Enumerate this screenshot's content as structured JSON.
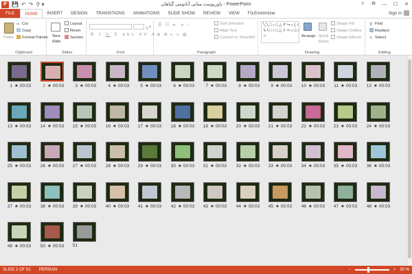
{
  "window": {
    "title": "پاورپوینت مبانی آناتومی گیاهان - PowerPoint",
    "controls": [
      "?",
      "⧉",
      "—",
      "☐",
      "✕"
    ]
  },
  "qat": {
    "save": "💾",
    "undo": "↶",
    "redo": "↷",
    "more": "⚲ ▾"
  },
  "tabs": [
    "FILE",
    "HOME",
    "INSERT",
    "DESIGN",
    "TRANSITIONS",
    "ANIMATIONS",
    "SLIDE SHOW",
    "REVIEW",
    "VIEW",
    "FILEminimizer"
  ],
  "active_tab": "HOME",
  "signin": "Sign in",
  "ribbon": {
    "clipboard": {
      "paste": "Paste",
      "cut": "Cut",
      "copy": "Copy",
      "format_painter": "Format Painter",
      "label": "Clipboard"
    },
    "slides": {
      "new_slide": "New Slide",
      "layout": "Layout",
      "reset": "Reset",
      "section": "Section",
      "label": "Slides"
    },
    "font": {
      "font_name": "",
      "font_size": "",
      "label": "Font"
    },
    "paragraph": {
      "text_direction": "Text Direction",
      "align_text": "Align Text",
      "smartart": "Convert to SmartArt",
      "label": "Paragraph"
    },
    "drawing": {
      "shapes_glyphs": "╲╲□○□△↱↪⌐{☆}↳\\□○□△⇩⇨⌂◇⬠⌐{}☆",
      "arrange": "Arrange",
      "quick_styles": "Quick Styles",
      "shape_fill": "Shape Fill",
      "shape_outline": "Shape Outline",
      "shape_effects": "Shape Effects",
      "label": "Drawing"
    },
    "editing": {
      "find": "Find",
      "replace": "Replace",
      "select": "Select",
      "label": "Editing"
    }
  },
  "slides": [
    {
      "n": "1",
      "star": "★",
      "time": "00:03",
      "color": "#7a6a8e"
    },
    {
      "n": "2",
      "star": "★",
      "time": "00:03",
      "color": "#d8b0b0",
      "selected": true
    },
    {
      "n": "3",
      "star": "★",
      "time": "00:03",
      "color": "#c98fae"
    },
    {
      "n": "4",
      "star": "★",
      "time": "00:03",
      "color": "#c9b7c7"
    },
    {
      "n": "5",
      "star": "★",
      "time": "00:03",
      "color": "#6f8fc0"
    },
    {
      "n": "6",
      "star": "★",
      "time": "00:03",
      "color": "#c9d7c2"
    },
    {
      "n": "7",
      "star": "★",
      "time": "00:03",
      "color": "#cfd7c7"
    },
    {
      "n": "8",
      "star": "★",
      "time": "00:03",
      "color": "#b4a8c6"
    },
    {
      "n": "9",
      "star": "★",
      "time": "00:03",
      "color": "#ccc7d8"
    },
    {
      "n": "10",
      "star": "★",
      "time": "00:03",
      "color": "#d9c2c9"
    },
    {
      "n": "11",
      "star": "★",
      "time": "00:03",
      "color": "#d0d4e0"
    },
    {
      "n": "12",
      "star": "★",
      "time": "00:03",
      "color": "#b2b0b9"
    },
    {
      "n": "13",
      "star": "★",
      "time": "00:03",
      "color": "#6aa8b9"
    },
    {
      "n": "14",
      "star": "★",
      "time": "00:03",
      "color": "#a18bb8"
    },
    {
      "n": "15",
      "star": "★",
      "time": "00:03",
      "color": "#b6c7b7"
    },
    {
      "n": "16",
      "star": "★",
      "time": "00:03",
      "color": "#bfb7a8"
    },
    {
      "n": "17",
      "star": "★",
      "time": "00:03",
      "color": "#d8d6cf"
    },
    {
      "n": "18",
      "star": "★",
      "time": "00:03",
      "color": "#4e6fa0"
    },
    {
      "n": "19",
      "star": "★",
      "time": "00:03",
      "color": "#d7cf9f"
    },
    {
      "n": "20",
      "star": "★",
      "time": "00:03",
      "color": "#cfd6cc"
    },
    {
      "n": "21",
      "star": "★",
      "time": "00:03",
      "color": "#d3d3cf"
    },
    {
      "n": "22",
      "star": "★",
      "time": "00:03",
      "color": "#c86a9a"
    },
    {
      "n": "23",
      "star": "★",
      "time": "00:03",
      "color": "#b9c98a"
    },
    {
      "n": "24",
      "star": "★",
      "time": "00:03",
      "color": "#9eb38a"
    },
    {
      "n": "25",
      "star": "★",
      "time": "00:03",
      "color": "#9fc0d0"
    },
    {
      "n": "26",
      "star": "★",
      "time": "00:03",
      "color": "#c9a8b8"
    },
    {
      "n": "27",
      "star": "★",
      "time": "00:03",
      "color": "#b7c6d0"
    },
    {
      "n": "28",
      "star": "★",
      "time": "00:03",
      "color": "#cbbfa9"
    },
    {
      "n": "29",
      "star": "★",
      "time": "00:03",
      "color": "#5a7a3a"
    },
    {
      "n": "30",
      "star": "★",
      "time": "00:03",
      "color": "#8fbf7a"
    },
    {
      "n": "31",
      "star": "★",
      "time": "00:03",
      "color": "#d0d4cf"
    },
    {
      "n": "32",
      "star": "★",
      "time": "00:03",
      "color": "#b9cfa8"
    },
    {
      "n": "33",
      "star": "★",
      "time": "00:03",
      "color": "#d8d0c9"
    },
    {
      "n": "34",
      "star": "★",
      "time": "00:03",
      "color": "#d0c0d0"
    },
    {
      "n": "35",
      "star": "★",
      "time": "00:03",
      "color": "#e0b8c8"
    },
    {
      "n": "36",
      "star": "★",
      "time": "00:03",
      "color": "#9ec7d8"
    },
    {
      "n": "37",
      "star": "★",
      "time": "00:03",
      "color": "#c7cfa9"
    },
    {
      "n": "38",
      "star": "★",
      "time": "00:03",
      "color": "#8ec0c0"
    },
    {
      "n": "39",
      "star": "★",
      "time": "00:03",
      "color": "#cbd0c0"
    },
    {
      "n": "40",
      "star": "★",
      "time": "00:03",
      "color": "#d8c0a8"
    },
    {
      "n": "41",
      "star": "★",
      "time": "00:03",
      "color": "#c0c7d0"
    },
    {
      "n": "42",
      "star": "★",
      "time": "00:03",
      "color": "#b8b8b8"
    },
    {
      "n": "43",
      "star": "★",
      "time": "00:03",
      "color": "#d0c8c0"
    },
    {
      "n": "44",
      "star": "★",
      "time": "00:03",
      "color": "#d8d0c0"
    },
    {
      "n": "45",
      "star": "★",
      "time": "00:03",
      "color": "#c89a60"
    },
    {
      "n": "46",
      "star": "★",
      "time": "00:03",
      "color": "#b8c0b0"
    },
    {
      "n": "47",
      "star": "★",
      "time": "00:03",
      "color": "#8fb09a"
    },
    {
      "n": "48",
      "star": "★",
      "time": "00:03",
      "color": "#c8b8d0"
    },
    {
      "n": "49",
      "star": "★",
      "time": "00:03",
      "color": "#c9d4b9"
    },
    {
      "n": "50",
      "star": "★",
      "time": "00:03",
      "color": "#a85a4a"
    },
    {
      "n": "51",
      "star": "",
      "time": "",
      "color": "#9a9a9a"
    }
  ],
  "status": {
    "slide_info": "SLIDE 2 OF 51",
    "language": "PERSIAN",
    "zoom": "30 %",
    "zoom_fraction": 0.3
  },
  "colors": {
    "accent": "#d24726",
    "background": "#eaeaea",
    "slide_frame": "#1e2a12"
  }
}
